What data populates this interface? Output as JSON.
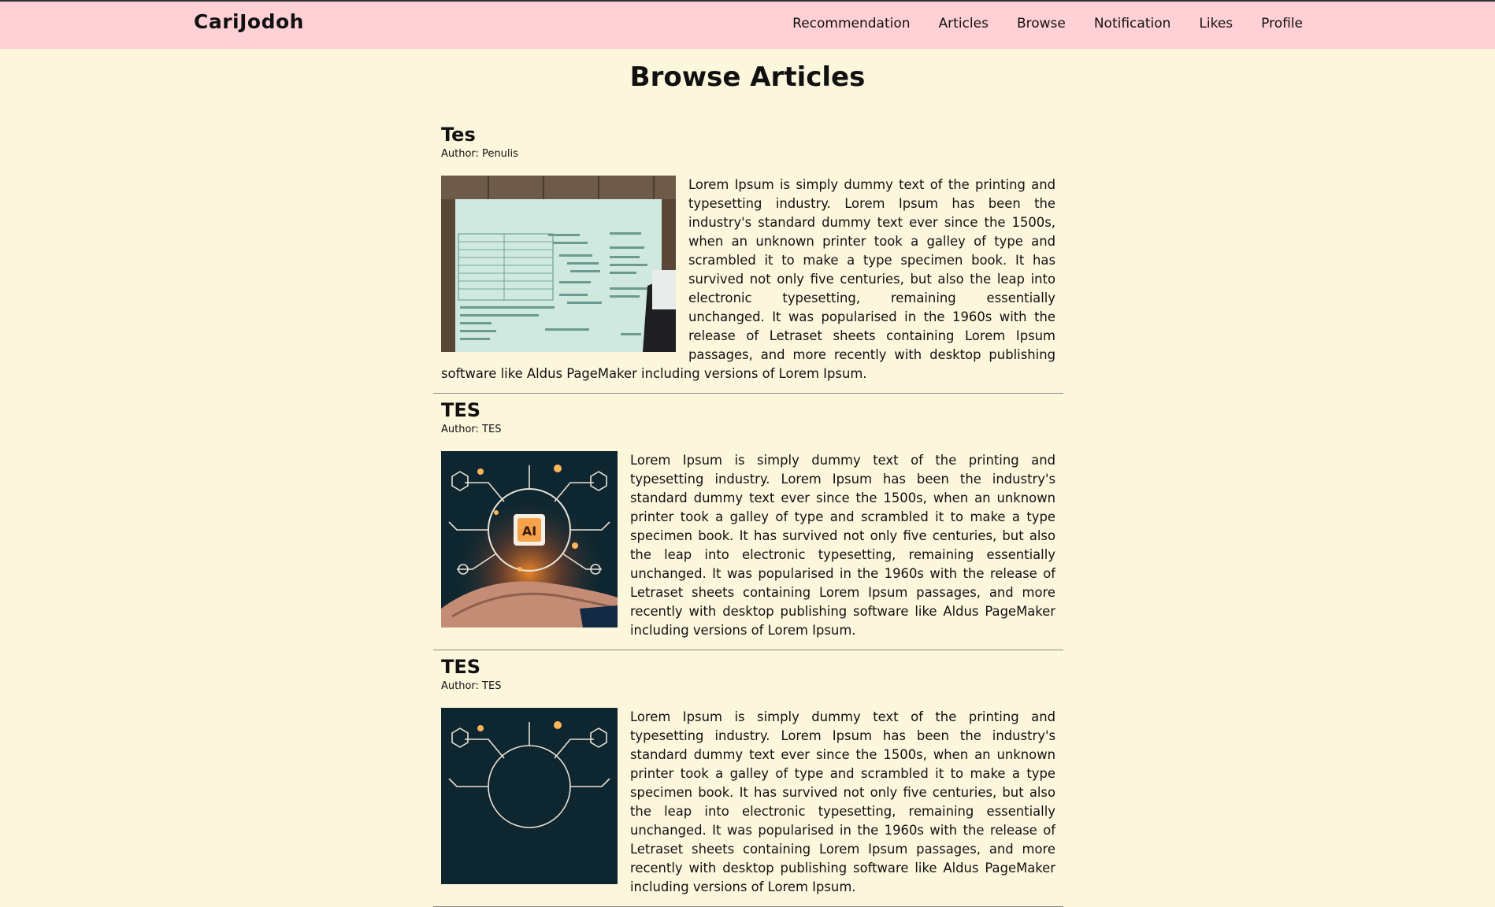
{
  "brand": "CariJodoh",
  "nav": {
    "items": [
      "Recommendation",
      "Articles",
      "Browse",
      "Notification",
      "Likes",
      "Profile"
    ]
  },
  "page_title": "Browse Articles",
  "articles": [
    {
      "title": "Tes",
      "author": "Author: Penulis",
      "body": "Lorem Ipsum is simply dummy text of the printing and typesetting industry. Lorem Ipsum has been the industry's standard dummy text ever since the 1500s, when an unknown printer took a galley of type and scrambled it to make a type specimen book. It has survived not only five centuries, but also the leap into electronic typesetting, remaining essentially unchanged. It was popularised in the 1960s with the release of Letraset sheets containing Lorem Ipsum passages, and more recently with desktop publishing software like Aldus PageMaker including versions of Lorem Ipsum."
    },
    {
      "title": "TES",
      "author": "Author: TES",
      "body": "Lorem Ipsum is simply dummy text of the printing and typesetting industry. Lorem Ipsum has been the industry's standard dummy text ever since the 1500s, when an unknown printer took a galley of type and scrambled it to make a type specimen book. It has survived not only five centuries, but also the leap into electronic typesetting, remaining essentially unchanged. It was popularised in the 1960s with the release of Letraset sheets containing Lorem Ipsum passages, and more recently with desktop publishing software like Aldus PageMaker including versions of Lorem Ipsum."
    },
    {
      "title": "TES",
      "author": "Author: TES",
      "body": "Lorem Ipsum is simply dummy text of the printing and typesetting industry. Lorem Ipsum has been the industry's standard dummy text ever since the 1500s, when an unknown printer took a galley of type and scrambled it to make a type specimen book. It has survived not only five centuries, but also the leap into electronic typesetting, remaining essentially unchanged. It was popularised in the 1960s with the release of Letraset sheets containing Lorem Ipsum passages, and more recently with desktop publishing software like Aldus PageMaker including versions of Lorem Ipsum."
    }
  ],
  "ai_label": "AI",
  "colors": {
    "navbar_bg": "#ffd0d6",
    "page_bg": "#fcf6dc",
    "divider": "#8a8a84"
  }
}
